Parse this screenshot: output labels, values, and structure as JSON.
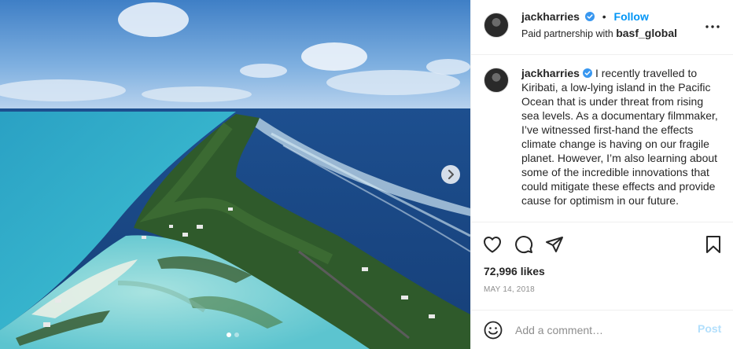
{
  "post": {
    "author": {
      "username": "jackharries",
      "verified": true,
      "follow_label": "Follow",
      "separator": "•"
    },
    "partnership": {
      "prefix": "Paid partnership with",
      "partner": "basf_global"
    },
    "caption": "I recently travelled to Kiribati, a low-lying island in the Pacific Ocean that is under threat from rising sea levels. As a documentary filmmaker, I’ve witnessed first-hand the effects climate change is having on our fragile planet. However, I’m also learning about some of the incredible innovations that could mitigate these effects and provide cause for optimism in our future.",
    "likes": "72,996 likes",
    "date": "MAY 14, 2018",
    "carousel": {
      "slides": 2,
      "active_index": 0
    },
    "comment": {
      "placeholder": "Add a comment…",
      "post_label": "Post"
    },
    "icons": {
      "more": "more-options-icon",
      "like": "heart-icon",
      "comment": "comment-icon",
      "share": "share-icon",
      "save": "bookmark-icon",
      "emoji": "emoji-icon",
      "next": "chevron-right-icon",
      "verified": "verified-badge-icon"
    },
    "colors": {
      "link": "#0095f6",
      "verified": "#3897f0",
      "post_disabled": "#b2dffc",
      "muted": "#8e8e8e"
    }
  }
}
